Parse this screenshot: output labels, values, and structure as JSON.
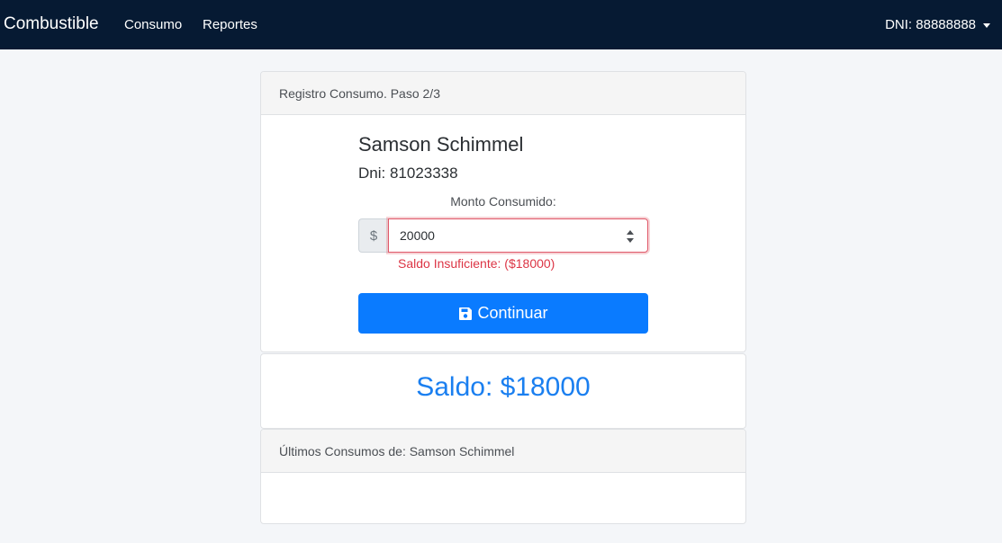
{
  "navbar": {
    "brand": "Combustible",
    "links": [
      "Consumo",
      "Reportes"
    ],
    "user": "DNI: 88888888"
  },
  "registro": {
    "header": "Registro Consumo. Paso 2/3",
    "client_name": "Samson Schimmel",
    "client_dni": "Dni: 81023338",
    "monto_label": "Monto Consumido:",
    "currency_prefix": "$",
    "amount_value": "20000",
    "error": "Saldo Insuficiente: ($18000)",
    "button_label": "Continuar",
    "button_icon": "save-icon"
  },
  "saldo": {
    "text": "Saldo: $18000"
  },
  "ultimos": {
    "header": "Últimos Consumos de: Samson Schimmel"
  },
  "colors": {
    "navbar_bg": "#061a33",
    "primary": "#0a7bff",
    "danger": "#dc3545",
    "saldo_text": "#1a7ff0"
  }
}
